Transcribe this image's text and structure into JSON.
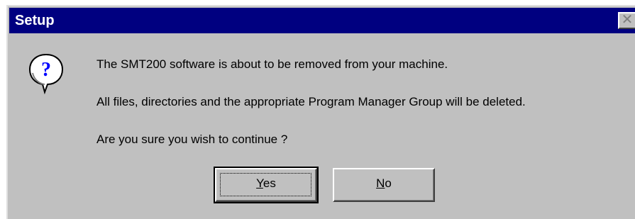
{
  "window": {
    "title": "Setup",
    "close_glyph": "✕"
  },
  "icon": "question-icon",
  "messages": {
    "line1": "The SMT200 software is about to be removed from your machine.",
    "line2": "All files, directories and the appropriate Program Manager Group will be deleted.",
    "line3": "Are you sure you wish to continue ?"
  },
  "buttons": {
    "yes": {
      "mnemonic": "Y",
      "rest": "es"
    },
    "no": {
      "mnemonic": "N",
      "rest": "o"
    }
  },
  "colors": {
    "titlebar": "#000080",
    "face": "#c0c0c0",
    "title_text": "#ffffff"
  }
}
